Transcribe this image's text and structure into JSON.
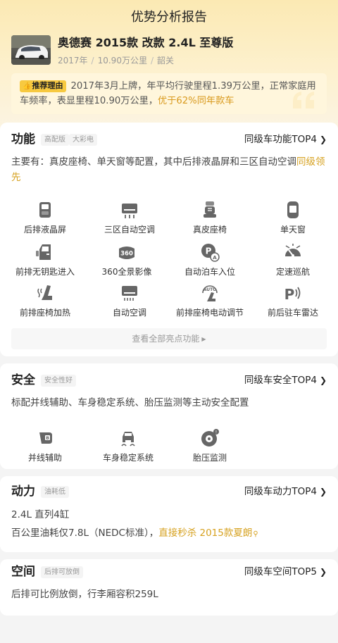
{
  "page": {
    "title": "优势分析报告"
  },
  "car": {
    "name": "奥德赛 2015款 改款 2.4L 至尊版",
    "year": "2017年",
    "mileage": "10.90万公里",
    "plate": "韶关"
  },
  "reason": {
    "tag": "推荐理由",
    "text": "2017年3月上牌，年平均行驶里程1.39万公里，正常家庭用车频率，表显里程10.90万公里，",
    "highlight": "优于62%同年款车"
  },
  "features": {
    "title": "功能",
    "tags": [
      "高配版",
      "大彩电"
    ],
    "rank": "同级车功能TOP4",
    "desc": "主要有：真皮座椅、单天窗等配置，其中后排液晶屏和三区自动空调",
    "desc_highlight": "同级领先",
    "items": [
      {
        "icon": "rear-screen-icon",
        "label": "后排液晶屏"
      },
      {
        "icon": "climate-3zone-icon",
        "label": "三区自动空调"
      },
      {
        "icon": "leather-seat-icon",
        "label": "真皮座椅"
      },
      {
        "icon": "sunroof-icon",
        "label": "单天窗"
      },
      {
        "icon": "keyless-entry-icon",
        "label": "前排无钥匙进入"
      },
      {
        "icon": "camera-360-icon",
        "label": "360全景影像"
      },
      {
        "icon": "auto-parking-icon",
        "label": "自动泊车入位"
      },
      {
        "icon": "cruise-control-icon",
        "label": "定速巡航"
      },
      {
        "icon": "seat-heating-icon",
        "label": "前排座椅加热"
      },
      {
        "icon": "auto-ac-icon",
        "label": "自动空调"
      },
      {
        "icon": "power-seat-icon",
        "label": "前排座椅电动调节"
      },
      {
        "icon": "parking-radar-icon",
        "label": "前后驻车雷达"
      }
    ],
    "view_all": "查看全部亮点功能"
  },
  "safety": {
    "title": "安全",
    "tag": "安全性好",
    "rank": "同级车安全TOP4",
    "desc": "标配并线辅助、车身稳定系统、胎压监测等主动安全配置",
    "items": [
      {
        "icon": "lane-assist-icon",
        "label": "并线辅助"
      },
      {
        "icon": "stability-icon",
        "label": "车身稳定系统"
      },
      {
        "icon": "tire-pressure-icon",
        "label": "胎压监测"
      }
    ]
  },
  "power": {
    "title": "动力",
    "tag": "油耗低",
    "rank": "同级车动力TOP4",
    "engine": "2.4L 直列4缸",
    "fuel": "百公里油耗仅7.8L（NEDC标准），",
    "compare": "直接秒杀 2015款夏朗"
  },
  "space": {
    "title": "空间",
    "tag": "后排可放倒",
    "rank": "同级车空间TOP5",
    "desc": "后排可比例放倒，行李厢容积259L"
  },
  "colors": {
    "accent": "#d6a11f",
    "tag_bg": "#f7c940",
    "hero": "#fbe9b3"
  }
}
